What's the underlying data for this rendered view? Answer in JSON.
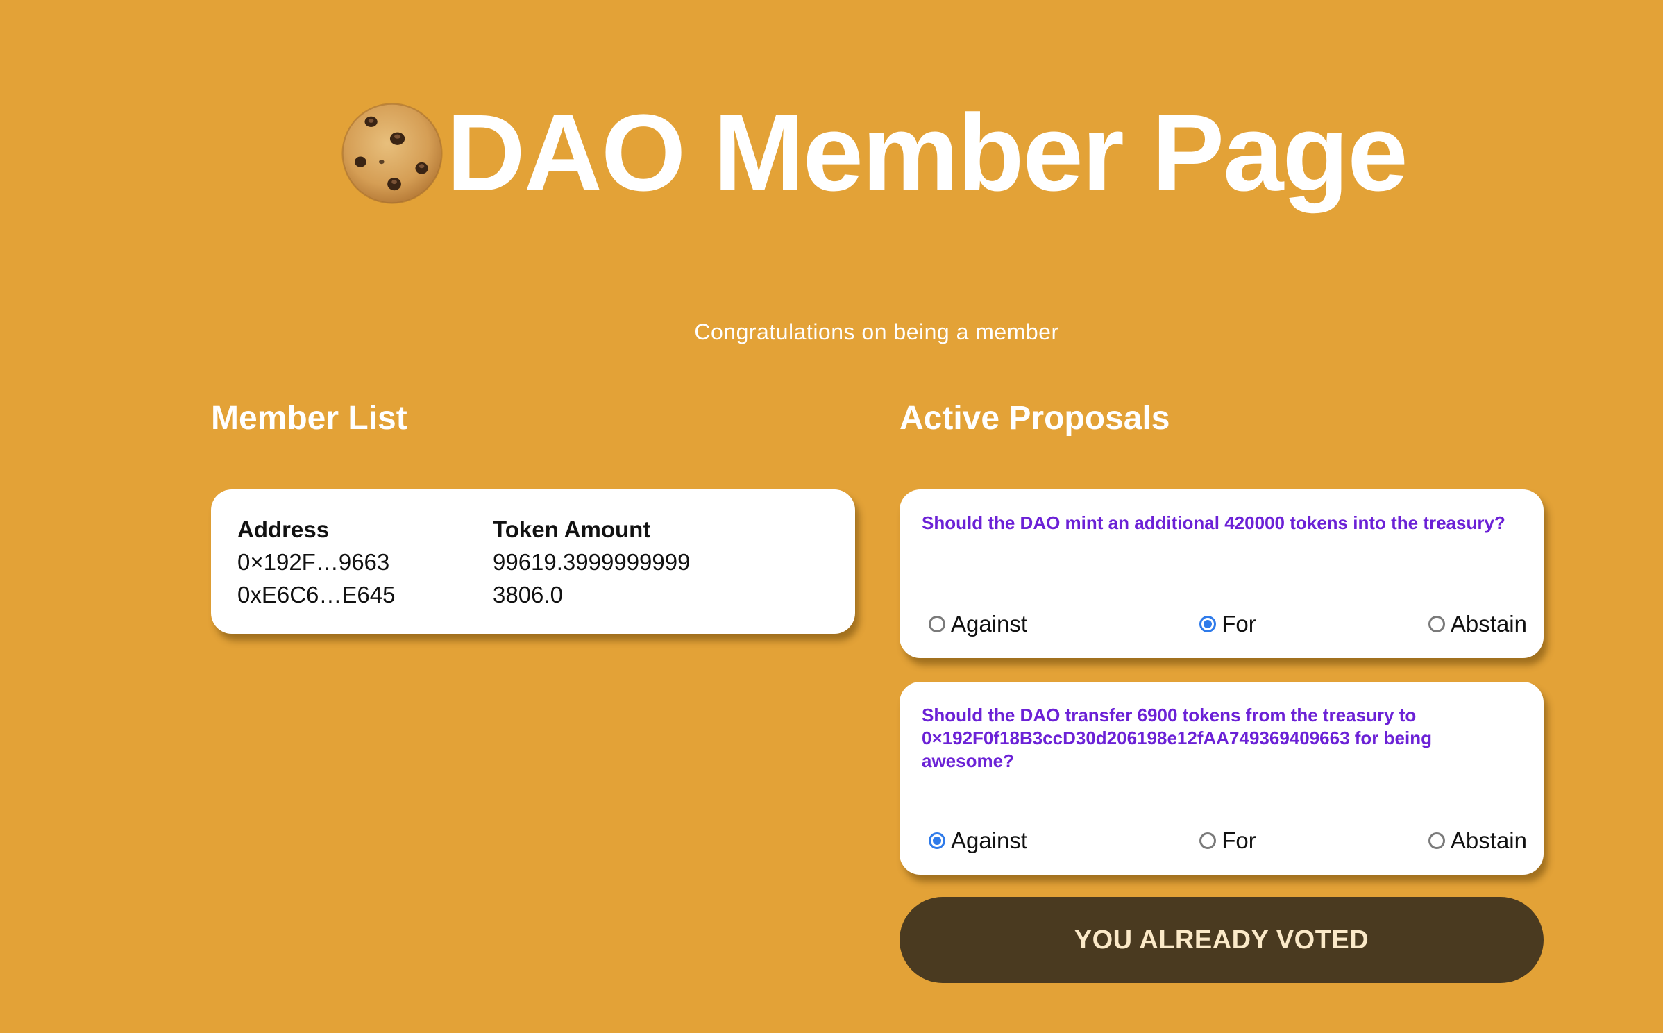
{
  "header": {
    "title": "DAO Member Page",
    "icon": "cookie-icon"
  },
  "subtitle": "Congratulations on being a member",
  "member_list": {
    "heading": "Member List",
    "columns": [
      "Address",
      "Token Amount"
    ],
    "rows": [
      {
        "address": "0×192F…9663",
        "tokens": "99619.3999999999"
      },
      {
        "address": "0xE6C6…E645",
        "tokens": "3806.0"
      }
    ]
  },
  "proposals": {
    "heading": "Active Proposals",
    "items": [
      {
        "question": "Should the DAO mint an additional 420000 tokens into the treasury?",
        "options": [
          "Against",
          "For",
          "Abstain"
        ],
        "selected": "For"
      },
      {
        "question": "Should the DAO transfer 6900 tokens from the treasury to 0×192F0f18B3ccD30d206198e12fAA749369409663 for being awesome?",
        "options": [
          "Against",
          "For",
          "Abstain"
        ],
        "selected": "Against"
      }
    ]
  },
  "vote_button": {
    "label": "YOU ALREADY VOTED"
  },
  "colors": {
    "background": "#E3A237",
    "question_text": "#6B21D6",
    "radio_selected": "#2F7BEA",
    "button_bg": "#4A3A20",
    "button_text": "#FBE9C8"
  }
}
